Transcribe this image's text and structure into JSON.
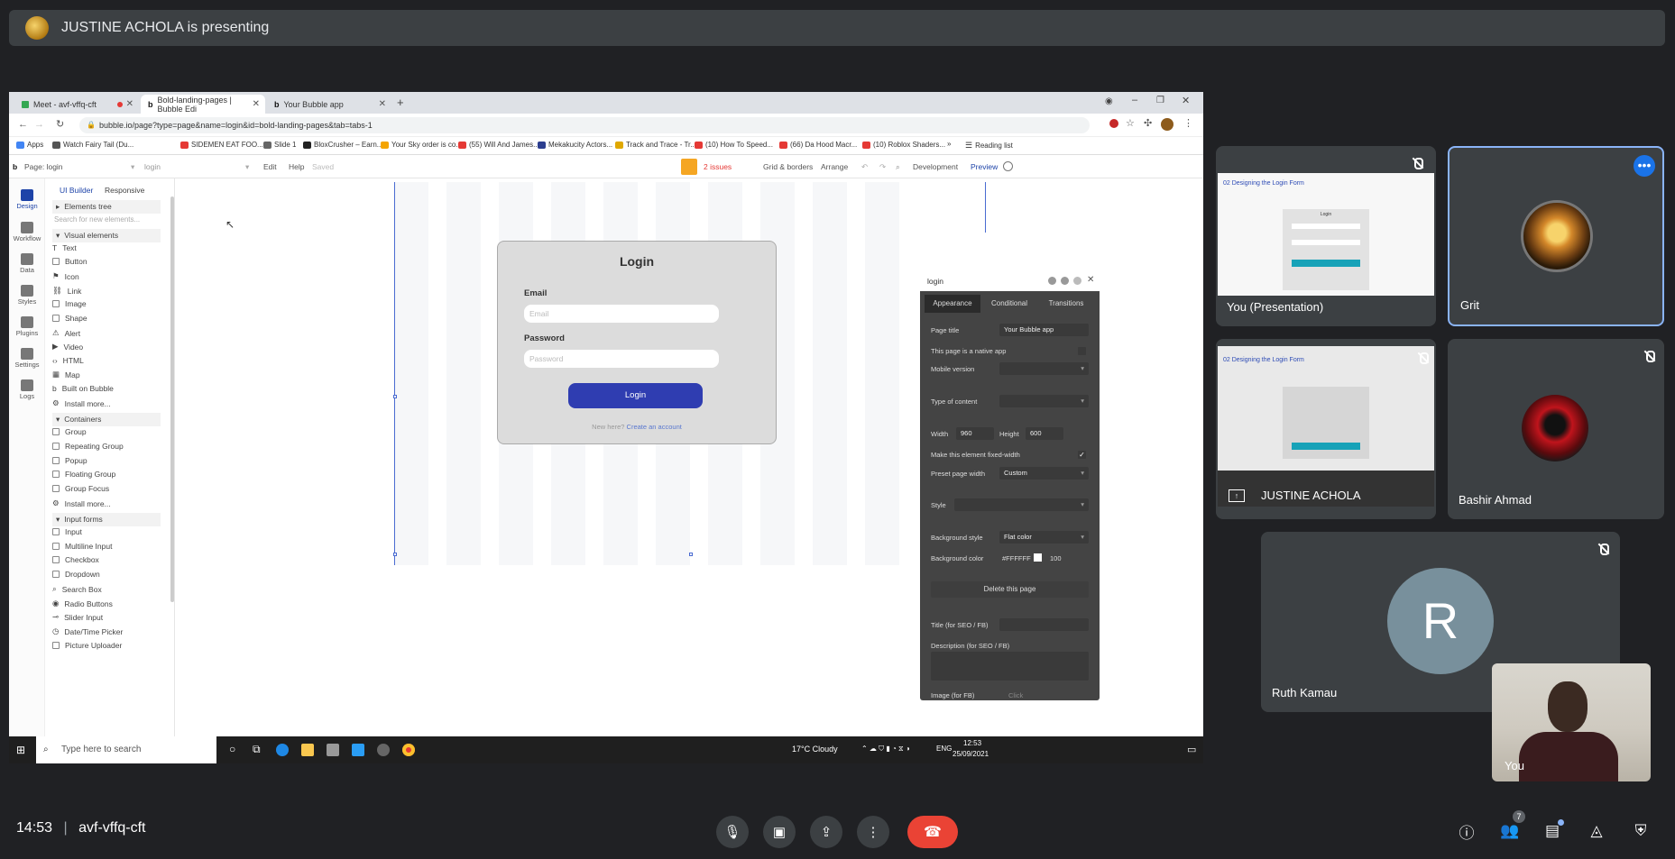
{
  "presenting": {
    "text": "JUSTINE ACHOLA is presenting"
  },
  "browser": {
    "tabs": [
      {
        "label": "Meet - avf-vffq-cft"
      },
      {
        "label": "Bold-landing-pages | Bubble Edi"
      },
      {
        "label": "Your Bubble app"
      }
    ],
    "new_tab": "+",
    "url": "bubble.io/page?type=page&name=login&id=bold-landing-pages&tab=tabs-1",
    "bookmarks": [
      "Apps",
      "Watch Fairy Tail (Du...",
      "SIDEMEN EAT FOO...",
      "Slide 1",
      "BloxCrusher – Earn...",
      "Your Sky order is co...",
      "(55) Will And James...",
      "Mekakucity Actors...",
      "Track and Trace - Tr...",
      "(10) How To Speed...",
      "(66) Da Hood Macr...",
      "(10) Roblox Shaders..."
    ],
    "reading_list": "Reading list"
  },
  "bubble": {
    "page_select": "Page: login",
    "element_select": "login",
    "menu": {
      "edit": "Edit",
      "help": "Help",
      "saved": "Saved"
    },
    "issues": "2 issues",
    "grid": "Grid & borders",
    "arrange": "Arrange",
    "env": "Development",
    "preview": "Preview",
    "tools": [
      "Design",
      "Workflow",
      "Data",
      "Styles",
      "Plugins",
      "Settings",
      "Logs"
    ],
    "palette": {
      "tab_ui": "UI Builder",
      "tab_responsive": "Responsive",
      "elements_tree": "Elements tree",
      "search": "Search for new elements...",
      "visual_section": "Visual elements",
      "visual": [
        "Text",
        "Button",
        "Icon",
        "Link",
        "Image",
        "Shape",
        "Alert",
        "Video",
        "HTML",
        "Map",
        "Built on Bubble",
        "Install more..."
      ],
      "containers_section": "Containers",
      "containers": [
        "Group",
        "Repeating Group",
        "Popup",
        "Floating Group",
        "Group Focus",
        "Install more..."
      ],
      "inputs_section": "Input forms",
      "inputs": [
        "Input",
        "Multiline Input",
        "Checkbox",
        "Dropdown",
        "Search Box",
        "Radio Buttons",
        "Slider Input",
        "Date/Time Picker",
        "Picture Uploader"
      ]
    },
    "login_card": {
      "title": "Login",
      "email_label": "Email",
      "email_placeholder": "Email",
      "password_label": "Password",
      "password_placeholder": "Password",
      "button": "Login",
      "footer_text": "New here?",
      "footer_link": "Create an account"
    },
    "props": {
      "title": "login",
      "tabs": [
        "Appearance",
        "Conditional",
        "Transitions"
      ],
      "page_title_label": "Page title",
      "page_title_value": "Your Bubble app",
      "native_app": "This page is a native app",
      "mobile_version": "Mobile version",
      "type_of_content": "Type of content",
      "width_label": "Width",
      "width_value": "960",
      "height_label": "Height",
      "height_value": "600",
      "fixed_width": "Make this element fixed-width",
      "preset_label": "Preset page width",
      "preset_value": "Custom",
      "style_label": "Style",
      "bg_style_label": "Background style",
      "bg_style_value": "Flat color",
      "bg_color_label": "Background color",
      "bg_color_value": "#FFFFFF",
      "bg_opacity": "100",
      "delete": "Delete this page",
      "seo_title": "Title (for SEO / FB)",
      "seo_desc": "Description (for SEO / FB)",
      "image_fb": "Image (for FB)",
      "image_click": "Click"
    }
  },
  "taskbar": {
    "search": "Type here to search",
    "weather": "17°C  Cloudy",
    "lang": "ENG",
    "time": "12:53",
    "date": "25/09/2021"
  },
  "participants": [
    {
      "name": "You  (Presentation)"
    },
    {
      "name": "Grit"
    },
    {
      "name": "JUSTINE ACHOLA"
    },
    {
      "name": "Bashir Ahmad"
    },
    {
      "name": "Ruth Kamau",
      "initial": "R"
    },
    {
      "name": "You"
    }
  ],
  "slide_thumb": {
    "heading": "02   Designing the Login Form",
    "login_label": "Login"
  },
  "meeting": {
    "time": "14:53",
    "code": "avf-vffq-cft",
    "participant_count": "7"
  },
  "colors": {
    "end_call": "#ea4335",
    "accent_blue": "#8ab4f8",
    "bubble_button": "#2f3db1"
  }
}
